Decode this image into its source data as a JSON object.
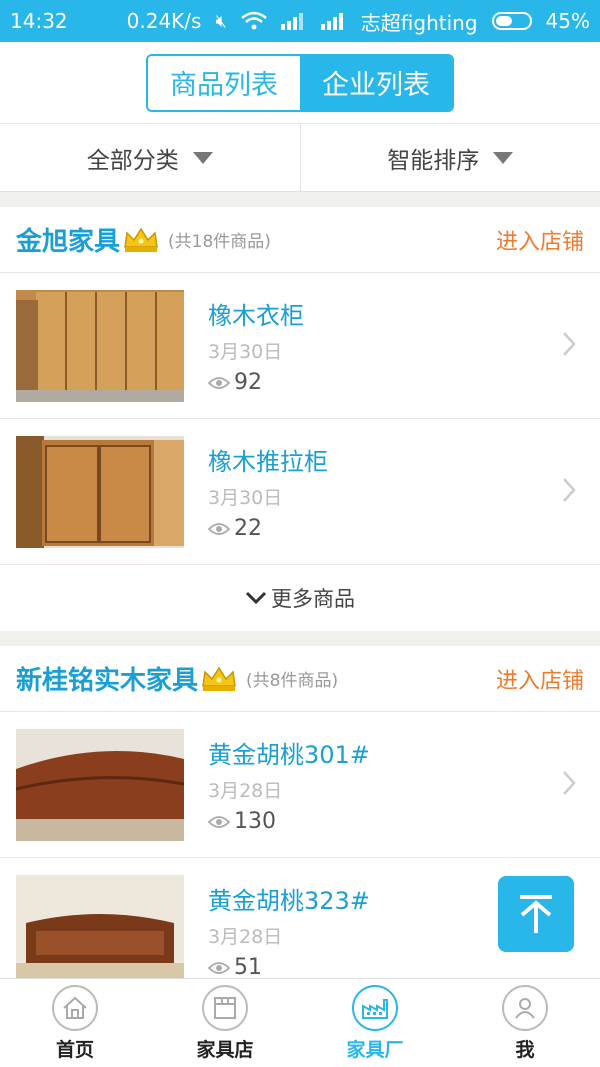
{
  "status_bar": {
    "time": "14:32",
    "speed": "0.24K/s",
    "carrier": "志超fighting",
    "battery": "45%"
  },
  "header": {
    "tabs": [
      {
        "label": "商品列表",
        "active": false
      },
      {
        "label": "企业列表",
        "active": true
      }
    ]
  },
  "filters": {
    "category": "全部分类",
    "sort": "智能排序"
  },
  "shops": [
    {
      "name": "金旭家具",
      "count": "(共18件商品)",
      "enter": "进入店铺",
      "items": [
        {
          "title": "橡木衣柜",
          "date": "3月30日",
          "views": "92"
        },
        {
          "title": "橡木推拉柜",
          "date": "3月30日",
          "views": "22"
        }
      ],
      "more": "更多商品"
    },
    {
      "name": "新桂铭实木家具",
      "count": "(共8件商品)",
      "enter": "进入店铺",
      "items": [
        {
          "title": "黄金胡桃301#",
          "date": "3月28日",
          "views": "130"
        },
        {
          "title": "黄金胡桃323#",
          "date": "3月28日",
          "views": "51"
        }
      ]
    }
  ],
  "tabbar": [
    {
      "label": "首页",
      "icon": "home-icon",
      "active": false
    },
    {
      "label": "家具店",
      "icon": "store-icon",
      "active": false
    },
    {
      "label": "家具厂",
      "icon": "factory-icon",
      "active": true
    },
    {
      "label": "我",
      "icon": "user-icon",
      "active": false
    }
  ],
  "colors": {
    "accent": "#29b6e8",
    "shop_name": "#1a9fd4",
    "enter": "#f07a2c"
  }
}
